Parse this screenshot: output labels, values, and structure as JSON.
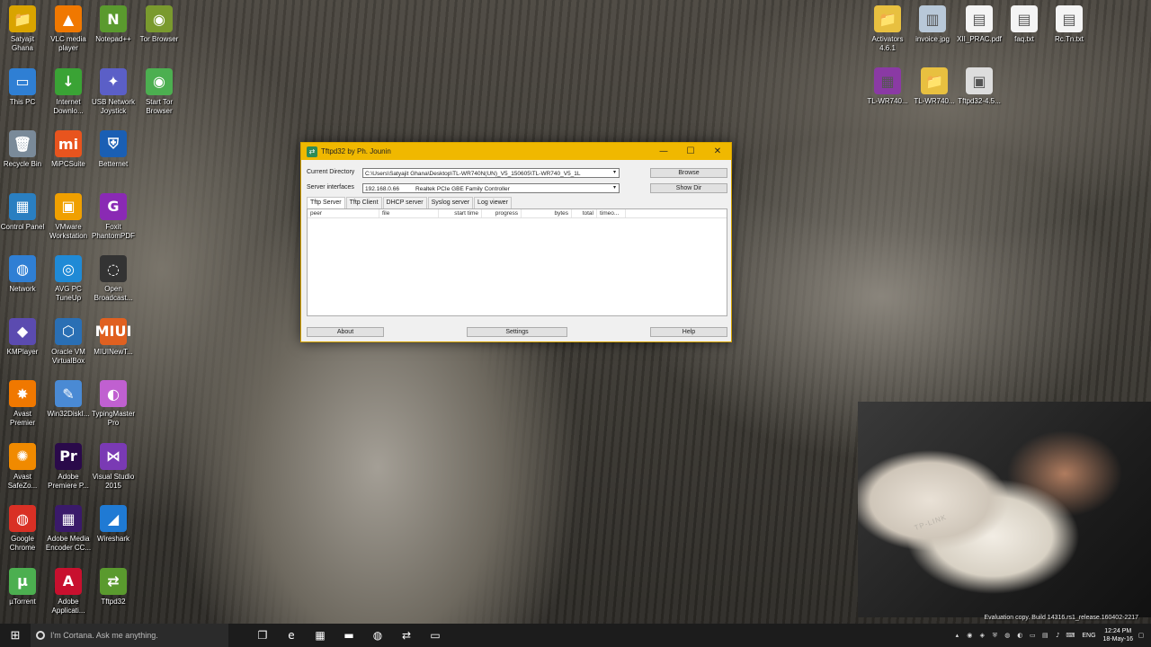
{
  "desktop": {
    "left_icons": [
      {
        "label": "Satyajit\nGhana",
        "glyph": "📁",
        "color": "#d9a400"
      },
      {
        "label": "VLC media\nplayer",
        "glyph": "▲",
        "color": "#f07800"
      },
      {
        "label": "Notepad++",
        "glyph": "N",
        "color": "#5a9a2e"
      },
      {
        "label": "Tor Browser",
        "glyph": "◉",
        "color": "#7a9a2e"
      },
      {
        "label": "This PC",
        "glyph": "▭",
        "color": "#2f7fd4"
      },
      {
        "label": "Internet\nDownlo...",
        "glyph": "↓",
        "color": "#3aa335"
      },
      {
        "label": "USB Network\nJoystick",
        "glyph": "✦",
        "color": "#5b5fc7"
      },
      {
        "label": "Start Tor\nBrowser",
        "glyph": "◉",
        "color": "#4caf50"
      },
      {
        "label": "Recycle Bin",
        "glyph": "🗑",
        "color": "#7a8a99"
      },
      {
        "label": "MiPCSuite",
        "glyph": "mi",
        "color": "#e8541e"
      },
      {
        "label": "Betternet",
        "glyph": "⛨",
        "color": "#1a5fb4"
      },
      {
        "label": "Control Panel",
        "glyph": "▦",
        "color": "#2a7fc1"
      },
      {
        "label": "VMware\nWorkstation",
        "glyph": "▣",
        "color": "#f0a000"
      },
      {
        "label": "Foxit\nPhantomPDF",
        "glyph": "G",
        "color": "#8a2ab4"
      },
      {
        "label": "Network",
        "glyph": "◍",
        "color": "#2f7fd4"
      },
      {
        "label": "AVG PC\nTuneUp",
        "glyph": "◎",
        "color": "#1f8ad6"
      },
      {
        "label": "Open\nBroadcast...",
        "glyph": "◌",
        "color": "#333333"
      },
      {
        "label": "KMPlayer",
        "glyph": "◆",
        "color": "#5b4bb0"
      },
      {
        "label": "Oracle VM\nVirtualBox",
        "glyph": "⬡",
        "color": "#2a6fb4"
      },
      {
        "label": "MIUINewT...",
        "glyph": "MIUI",
        "color": "#e06020"
      },
      {
        "label": "Avast\nPremier",
        "glyph": "✸",
        "color": "#f07800"
      },
      {
        "label": "Win32DiskI...",
        "glyph": "✎",
        "color": "#4a8ad4"
      },
      {
        "label": "TypingMaster\nPro",
        "glyph": "◐",
        "color": "#c060d0"
      },
      {
        "label": "Avast\nSafeZo...",
        "glyph": "✺",
        "color": "#f08a00"
      },
      {
        "label": "Adobe\nPremiere P...",
        "glyph": "Pr",
        "color": "#2a0a4a"
      },
      {
        "label": "Visual Studio\n2015",
        "glyph": "⋈",
        "color": "#7a3ab4"
      },
      {
        "label": "Google\nChrome",
        "glyph": "◍",
        "color": "#d93025"
      },
      {
        "label": "Adobe Media\nEncoder CC...",
        "glyph": "▦",
        "color": "#3a1a6a"
      },
      {
        "label": "Wireshark",
        "glyph": "◢",
        "color": "#1f7ad4"
      },
      {
        "label": "µTorrent",
        "glyph": "µ",
        "color": "#4caf50"
      },
      {
        "label": "Adobe\nApplicati...",
        "glyph": "A",
        "color": "#c8102e"
      },
      {
        "label": "Tftpd32",
        "glyph": "⇄",
        "color": "#5a9a2e"
      }
    ],
    "right_icons": [
      {
        "label": "Activators\n4.6.1",
        "glyph": "📁",
        "color": "#e8c040"
      },
      {
        "label": "invoice.jpg",
        "glyph": "▥",
        "color": "#b8c8d8"
      },
      {
        "label": "XII_PRAC.pdf",
        "glyph": "▤",
        "color": "#f4f4f4"
      },
      {
        "label": "faq.txt",
        "glyph": "▤",
        "color": "#f4f4f4"
      },
      {
        "label": "Rc.Tn.txt",
        "glyph": "▤",
        "color": "#f4f4f4"
      },
      {
        "label": "TL-WR740...",
        "glyph": "▦",
        "color": "#8a3aa4"
      },
      {
        "label": "TL-WR740...",
        "glyph": "📁",
        "color": "#e8c040"
      },
      {
        "label": "Tftpd32-4.5...",
        "glyph": "▣",
        "color": "#dddddd"
      }
    ]
  },
  "window": {
    "title": "Tftpd32 by Ph. Jounin",
    "current_directory_label": "Current Directory",
    "current_directory_value": "C:\\Users\\Satyajit Ghana\\Desktop\\TL-WR740N(UN)_V5_150605\\TL-WR740_V5_1L",
    "server_interfaces_label": "Server interfaces",
    "server_interfaces_value": "192.168.0.66          Realtek PCIe GBE Family Controller",
    "browse_button": "Browse",
    "show_dir_button": "Show Dir",
    "tabs": [
      "Tftp Server",
      "Tftp Client",
      "DHCP server",
      "Syslog server",
      "Log viewer"
    ],
    "columns": [
      "peer",
      "file",
      "start time",
      "progress",
      "bytes",
      "total",
      "timeo..."
    ],
    "about_button": "About",
    "settings_button": "Settings",
    "help_button": "Help",
    "minimize": "—",
    "maximize": "☐",
    "close": "✕"
  },
  "webcam_overlay": {
    "brand_text": "TP-LINK"
  },
  "watermark": "Evaluation copy. Build 14316.rs1_release.160402-2217",
  "taskbar": {
    "start_glyph": "⊞",
    "cortana_placeholder": "I'm Cortana. Ask me anything.",
    "apps": [
      {
        "name": "task-view-icon",
        "glyph": "❐"
      },
      {
        "name": "edge-icon",
        "glyph": "e"
      },
      {
        "name": "store-icon",
        "glyph": "▦"
      },
      {
        "name": "file-explorer-icon",
        "glyph": "▬"
      },
      {
        "name": "chrome-icon",
        "glyph": "◍"
      },
      {
        "name": "tftpd32-icon",
        "glyph": "⇄"
      },
      {
        "name": "app-icon",
        "glyph": "▭"
      }
    ],
    "language": "ENG",
    "time": "12:24 PM",
    "date": "18-May-16"
  }
}
